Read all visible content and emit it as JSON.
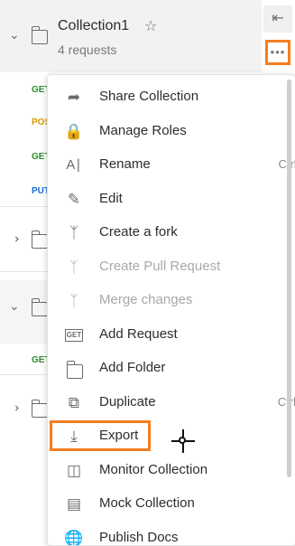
{
  "collection": {
    "title": "Collection1",
    "subtitle": "4 requests"
  },
  "requests": [
    {
      "method": "GET"
    },
    {
      "method": "POST"
    },
    {
      "method": "GET"
    },
    {
      "method": "PUT"
    }
  ],
  "other_requests": [
    {
      "method": "GET"
    }
  ],
  "colors": {
    "accent": "#f47e20",
    "get": "#2e8b2e",
    "post": "#d99a00",
    "put": "#1a6ed8"
  },
  "menu": {
    "items": [
      {
        "label": "Share Collection",
        "icon": "share-icon",
        "shortcut": "",
        "disabled": false
      },
      {
        "label": "Manage Roles",
        "icon": "lock-icon",
        "shortcut": "",
        "disabled": false
      },
      {
        "label": "Rename",
        "icon": "rename-icon",
        "shortcut": "Ctrl+E",
        "disabled": false
      },
      {
        "label": "Edit",
        "icon": "pencil-icon",
        "shortcut": "",
        "disabled": false
      },
      {
        "label": "Create a fork",
        "icon": "fork-icon",
        "shortcut": "",
        "disabled": false
      },
      {
        "label": "Create Pull Request",
        "icon": "pull-request-icon",
        "shortcut": "",
        "disabled": true
      },
      {
        "label": "Merge changes",
        "icon": "merge-icon",
        "shortcut": "",
        "disabled": true
      },
      {
        "label": "Add Request",
        "icon": "get-request-icon",
        "shortcut": "",
        "disabled": false
      },
      {
        "label": "Add Folder",
        "icon": "folder-plus-icon",
        "shortcut": "",
        "disabled": false
      },
      {
        "label": "Duplicate",
        "icon": "duplicate-icon",
        "shortcut": "Ctrl+D",
        "disabled": false
      },
      {
        "label": "Export",
        "icon": "download-icon",
        "shortcut": "",
        "disabled": false
      },
      {
        "label": "Monitor Collection",
        "icon": "monitor-icon",
        "shortcut": "",
        "disabled": false
      },
      {
        "label": "Mock Collection",
        "icon": "server-icon",
        "shortcut": "",
        "disabled": false
      },
      {
        "label": "Publish Docs",
        "icon": "globe-icon",
        "shortcut": "",
        "disabled": false
      }
    ]
  }
}
